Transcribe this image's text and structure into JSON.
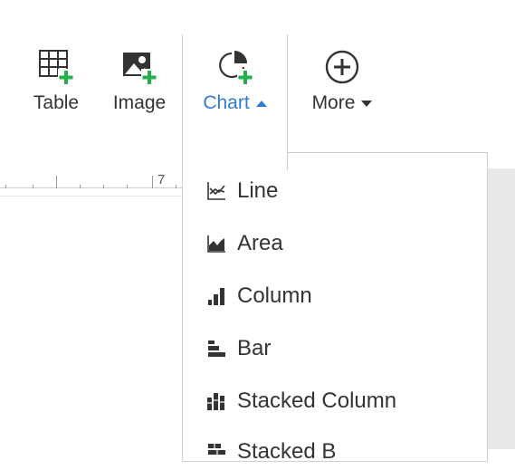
{
  "toolbar": {
    "table_label": "Table",
    "image_label": "Image",
    "chart_label": "Chart",
    "more_label": "More"
  },
  "ruler": {
    "mark_label": "7"
  },
  "chart_menu": {
    "items": [
      {
        "label": "Line",
        "icon": "line-chart-icon"
      },
      {
        "label": "Area",
        "icon": "area-chart-icon"
      },
      {
        "label": "Column",
        "icon": "column-chart-icon"
      },
      {
        "label": "Bar",
        "icon": "bar-chart-icon"
      },
      {
        "label": "Stacked Column",
        "icon": "stacked-column-chart-icon"
      },
      {
        "label": "Stacked B",
        "icon": "stacked-bar-chart-icon"
      }
    ]
  },
  "colors": {
    "accent_blue": "#2f7bd6",
    "plus_green": "#22b04b",
    "icon_dark": "#333333"
  }
}
